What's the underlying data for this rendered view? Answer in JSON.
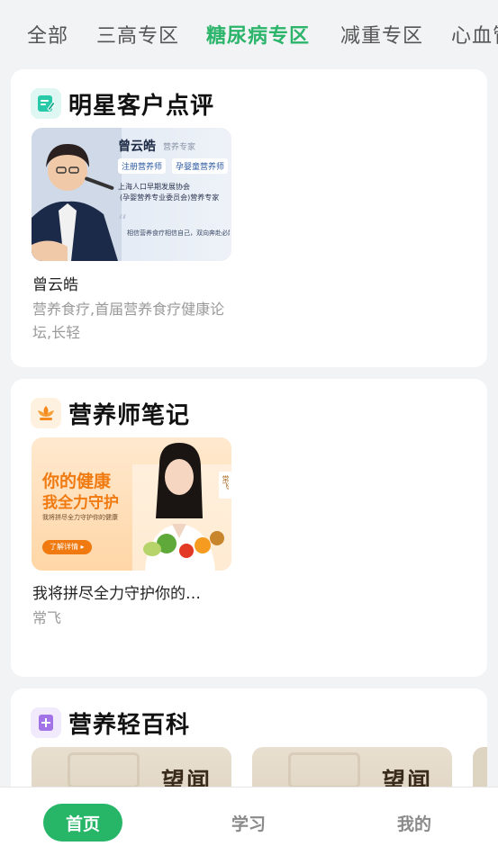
{
  "tabs": [
    {
      "label": "全部"
    },
    {
      "label": "三高专区"
    },
    {
      "label": "糖尿病专区",
      "active": true
    },
    {
      "label": "减重专区"
    },
    {
      "label": "心血管"
    }
  ],
  "reviews": {
    "title": "明星客户点评",
    "item": {
      "name": "曾云皓",
      "desc": "营养食疗,首届营养食疗健康论坛,长轻",
      "thumb": {
        "person_name": "曾云皓",
        "person_role": "营养专家",
        "tag1": "注册营养师",
        "tag2": "孕婴童营养师",
        "org_line1": "上海人口早期发展协会",
        "org_line2": "(孕婴营养专业委员会)营养专家",
        "quote": "相信营养食疗相信自己，双向奔赴必能成"
      }
    }
  },
  "notes": {
    "title": "营养师笔记",
    "item": {
      "title": "我将拼尽全力守护你的…",
      "author": "常飞",
      "thumb": {
        "headline1": "你的健康",
        "headline2": "我全力守护",
        "caption": "我将拼尽全力守护你的健康",
        "button": "了解详情",
        "badge": "常飞"
      }
    }
  },
  "encyclopedia": {
    "title": "营养轻百科",
    "items": [
      {
        "thumb_text": "望闻"
      },
      {
        "thumb_text": "望闻"
      }
    ]
  },
  "bottom_nav": [
    {
      "label": "首页",
      "active": true
    },
    {
      "label": "学习"
    },
    {
      "label": "我的"
    }
  ],
  "colors": {
    "accent": "#27b567",
    "orange": "#f58a1f",
    "purple": "#9b6be0"
  }
}
